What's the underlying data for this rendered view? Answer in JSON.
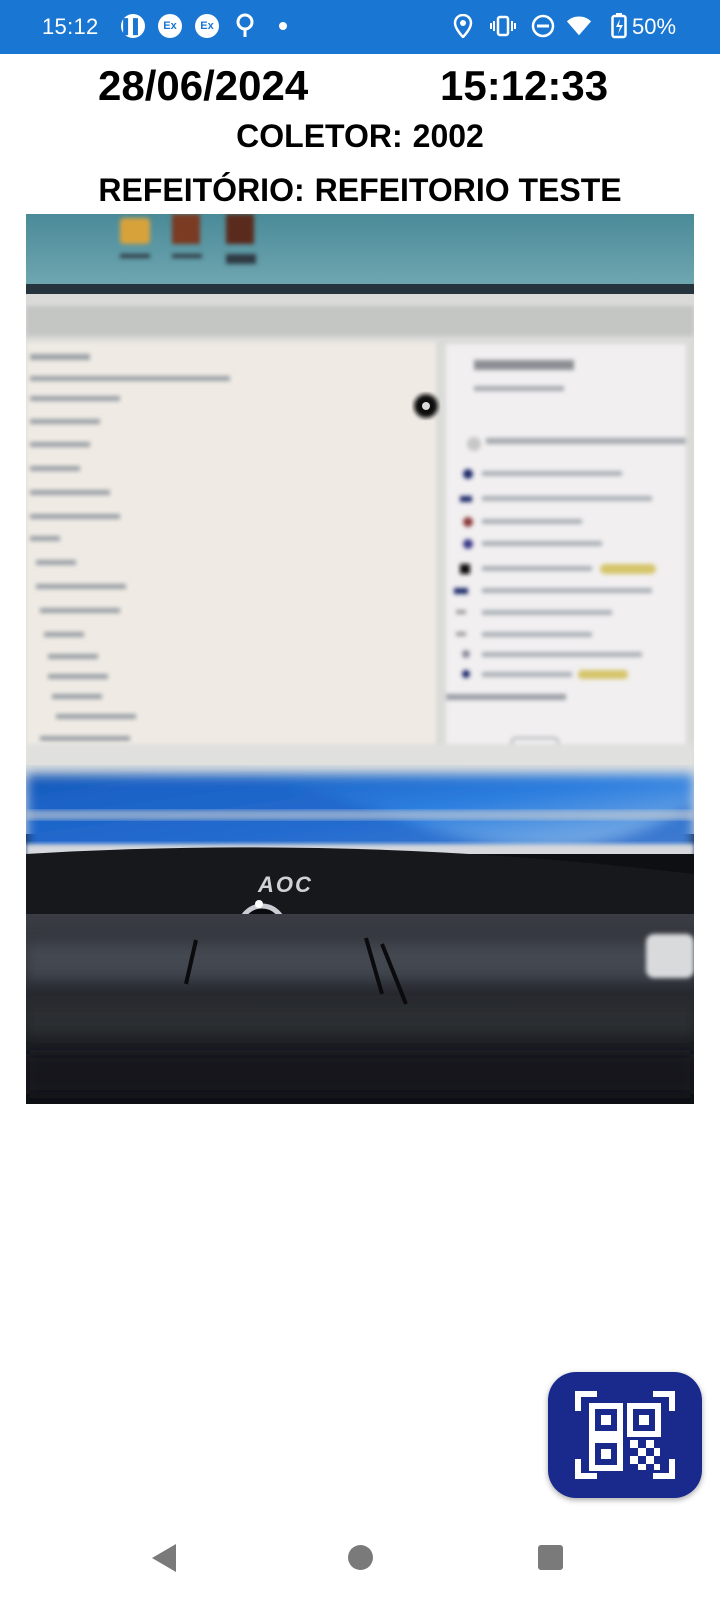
{
  "status_bar": {
    "time": "15:12",
    "icons": [
      "app-notification-icon",
      "exchange-icon",
      "exchange-icon",
      "location-pin-icon",
      "more-dot-icon",
      "location-icon",
      "vibrate-icon",
      "do-not-disturb-icon",
      "wifi-icon",
      "battery-charging-icon"
    ],
    "notif_ex_1": "Ex",
    "notif_ex_2": "Ex",
    "battery": "50%",
    "color": "#1976d2"
  },
  "header": {
    "date": "28/06/2024",
    "time": "15:12:33",
    "coletor_label": "COLETOR:",
    "coletor_value": "2002",
    "refeitorio_label": "REFEITÓRIO:",
    "refeitorio_value": "REFEITORIO TESTE"
  },
  "camera_preview": {
    "monitor_brand": "AOC"
  },
  "qr_button": {
    "icon": "qr-code-scan-icon",
    "color": "#1a2a8c"
  },
  "nav_bar": {
    "icons": [
      "back-icon",
      "home-icon",
      "recent-apps-icon"
    ]
  }
}
